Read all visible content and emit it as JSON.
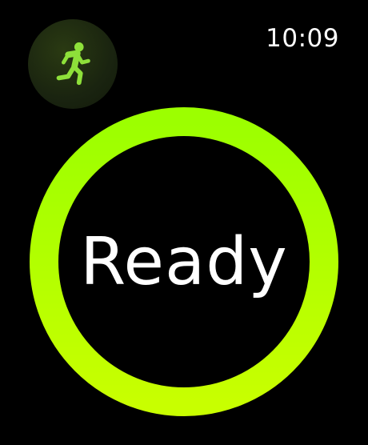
{
  "status_bar": {
    "time": "10:09"
  },
  "workout": {
    "icon": "running-figure-icon",
    "icon_color": "#8ee03a"
  },
  "countdown": {
    "label": "Ready",
    "ring_color_top": "#9cff00",
    "ring_color_bottom": "#c8ff00"
  }
}
